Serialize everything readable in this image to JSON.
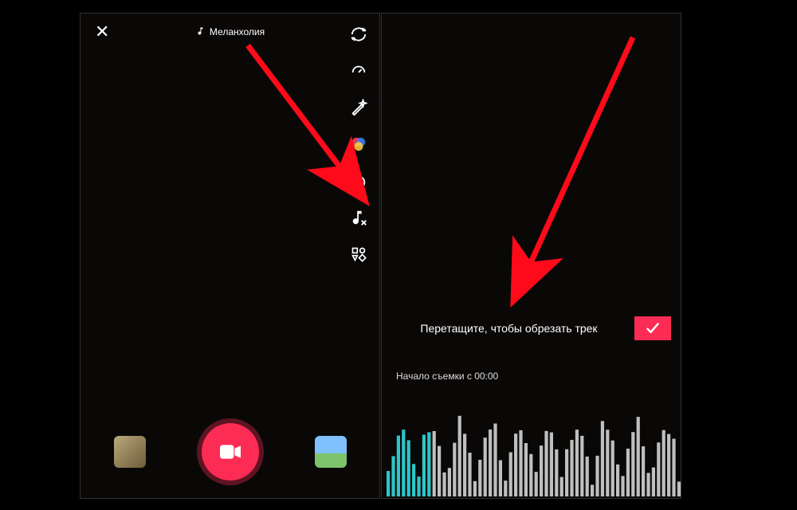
{
  "left": {
    "close_glyph": "✕",
    "sound_label": "Меланхолия",
    "tools": {
      "flip": "flip-camera-icon",
      "speed": "speed-off-icon",
      "beauty": "magic-wand-icon",
      "filters": "filters-icon",
      "timer": "timer-3s-icon",
      "trim_sound": "music-trim-icon",
      "more": "grid-icon"
    },
    "bottom": {
      "effects": "effects-thumb",
      "record": "record-button",
      "upload": "gallery-thumb"
    }
  },
  "right": {
    "trim_prompt": "Перетащите, чтобы обрезать трек",
    "confirm_glyph": "✓",
    "start_label": "Начало съемки с 00:00"
  },
  "colors": {
    "accent": "#fd2c55",
    "wave_active": "#2ec5c8",
    "wave_inactive": "#bfbfbf",
    "arrow": "#ff0a1a"
  }
}
